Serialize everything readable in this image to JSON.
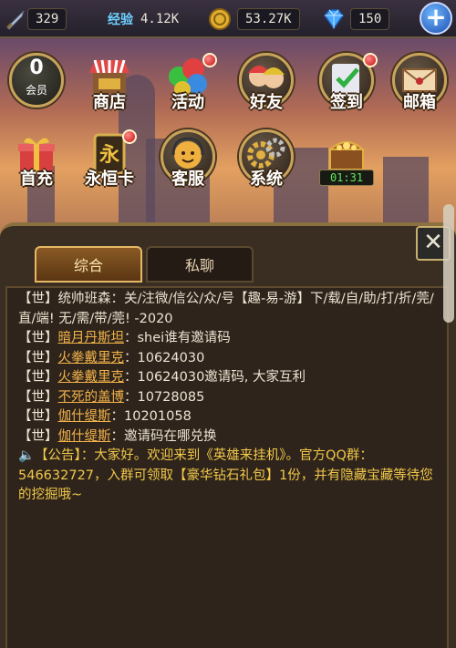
{
  "stats": {
    "sword": "329",
    "exp_label": "经验",
    "exp": "4.12K",
    "gold": "53.27K",
    "gems": "150"
  },
  "menu": {
    "vip_level": "0",
    "vip_label": "会员",
    "shop": "商店",
    "activity": "活动",
    "friends": "好友",
    "checkin": "签到",
    "mail": "邮箱",
    "first_recharge": "首充",
    "forever_card": "永恒卡",
    "customer_service": "客服",
    "system": "系统",
    "chest_timer": "01:31",
    "forever_card_glyph": "永"
  },
  "chat": {
    "tab_all": "综合",
    "tab_private": "私聊",
    "close_glyph": "✕",
    "messages": [
      {
        "tag": "【世】",
        "name": "统帅班森",
        "sep": "：",
        "text": "关/注微/信公/众/号【趣-易-游】下/载/自/助/打/折/莞/直/端! 无/需/带/莞! -2020"
      },
      {
        "tag": "【世】",
        "name": "暗月丹斯坦",
        "sep": "：",
        "text": "shei谁有邀请码"
      },
      {
        "tag": "【世】",
        "name": "火拳戴里克",
        "sep": "：",
        "text": "10624030"
      },
      {
        "tag": "【世】",
        "name": "火拳戴里克",
        "sep": "：",
        "text": "10624030邀请码, 大家互利"
      },
      {
        "tag": "【世】",
        "name": "不死的盖博",
        "sep": "：",
        "text": "10728085"
      },
      {
        "tag": "【世】",
        "name": "伽什缇斯",
        "sep": "：",
        "text": "10201058"
      },
      {
        "tag": "【世】",
        "name": "伽什缇斯",
        "sep": "：",
        "text": "邀请码在哪兑换"
      }
    ],
    "announcement": {
      "tag": "【公告】",
      "text": "：大家好。欢迎来到《英雄来挂机》。官方QQ群：546632727，入群可领取【豪华钻石礼包】1份，并有隐藏宝藏等待您的挖掘哦~"
    }
  },
  "colors": {
    "accent_gold": "#c8a35a",
    "name_orange": "#f2b24a",
    "timer_green": "#5eea5e",
    "exp_blue": "#6fd0ff"
  }
}
